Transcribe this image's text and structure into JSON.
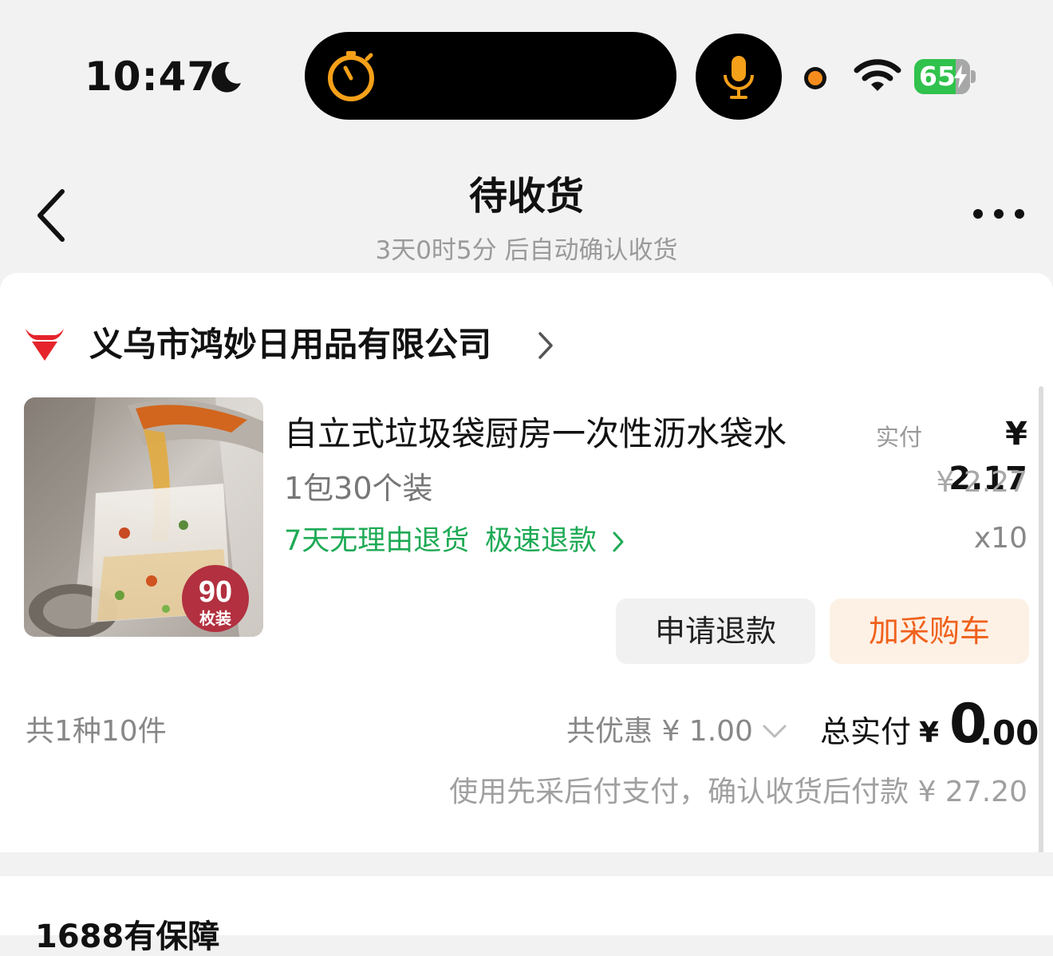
{
  "status_bar": {
    "time": "10:47",
    "battery_level": "65",
    "icons": [
      "moon-icon",
      "timer-icon",
      "microphone-icon",
      "recording-dot",
      "wifi-icon",
      "battery-icon"
    ]
  },
  "nav": {
    "title": "待收货",
    "subtitle": "3天0时5分 后自动确认收货"
  },
  "shop": {
    "name": "义乌市鸿妙日用品有限公司"
  },
  "product": {
    "name": "自立式垃圾袋厨房一次性沥水袋水",
    "spec": "1包30个装",
    "return_policy": "7天无理由退货",
    "fast_refund": "极速退款",
    "paid_label": "实付",
    "paid_price": "¥ 2.17",
    "original_price": "¥ 2.27",
    "quantity": "x10",
    "image_badge_number": "90",
    "image_badge_text": "枚装"
  },
  "actions": {
    "refund": "申请退款",
    "add_to_cart": "加采购车"
  },
  "summary": {
    "count": "共1种10件",
    "discount": "共优惠 ¥ 1.00",
    "total_label": "总实付",
    "total_currency": "¥",
    "total_int": "0",
    "total_dec": ".00",
    "pay_note": "使用先采后付支付，确认收货后付款 ¥ 27.20"
  },
  "next_section": {
    "title": "1688有保障"
  },
  "colors": {
    "green": "#1eaa55",
    "orange": "#f0611b",
    "orange_bg": "#fdf1e6",
    "battery_green": "#30c24c",
    "island_orange": "#f5a019"
  }
}
